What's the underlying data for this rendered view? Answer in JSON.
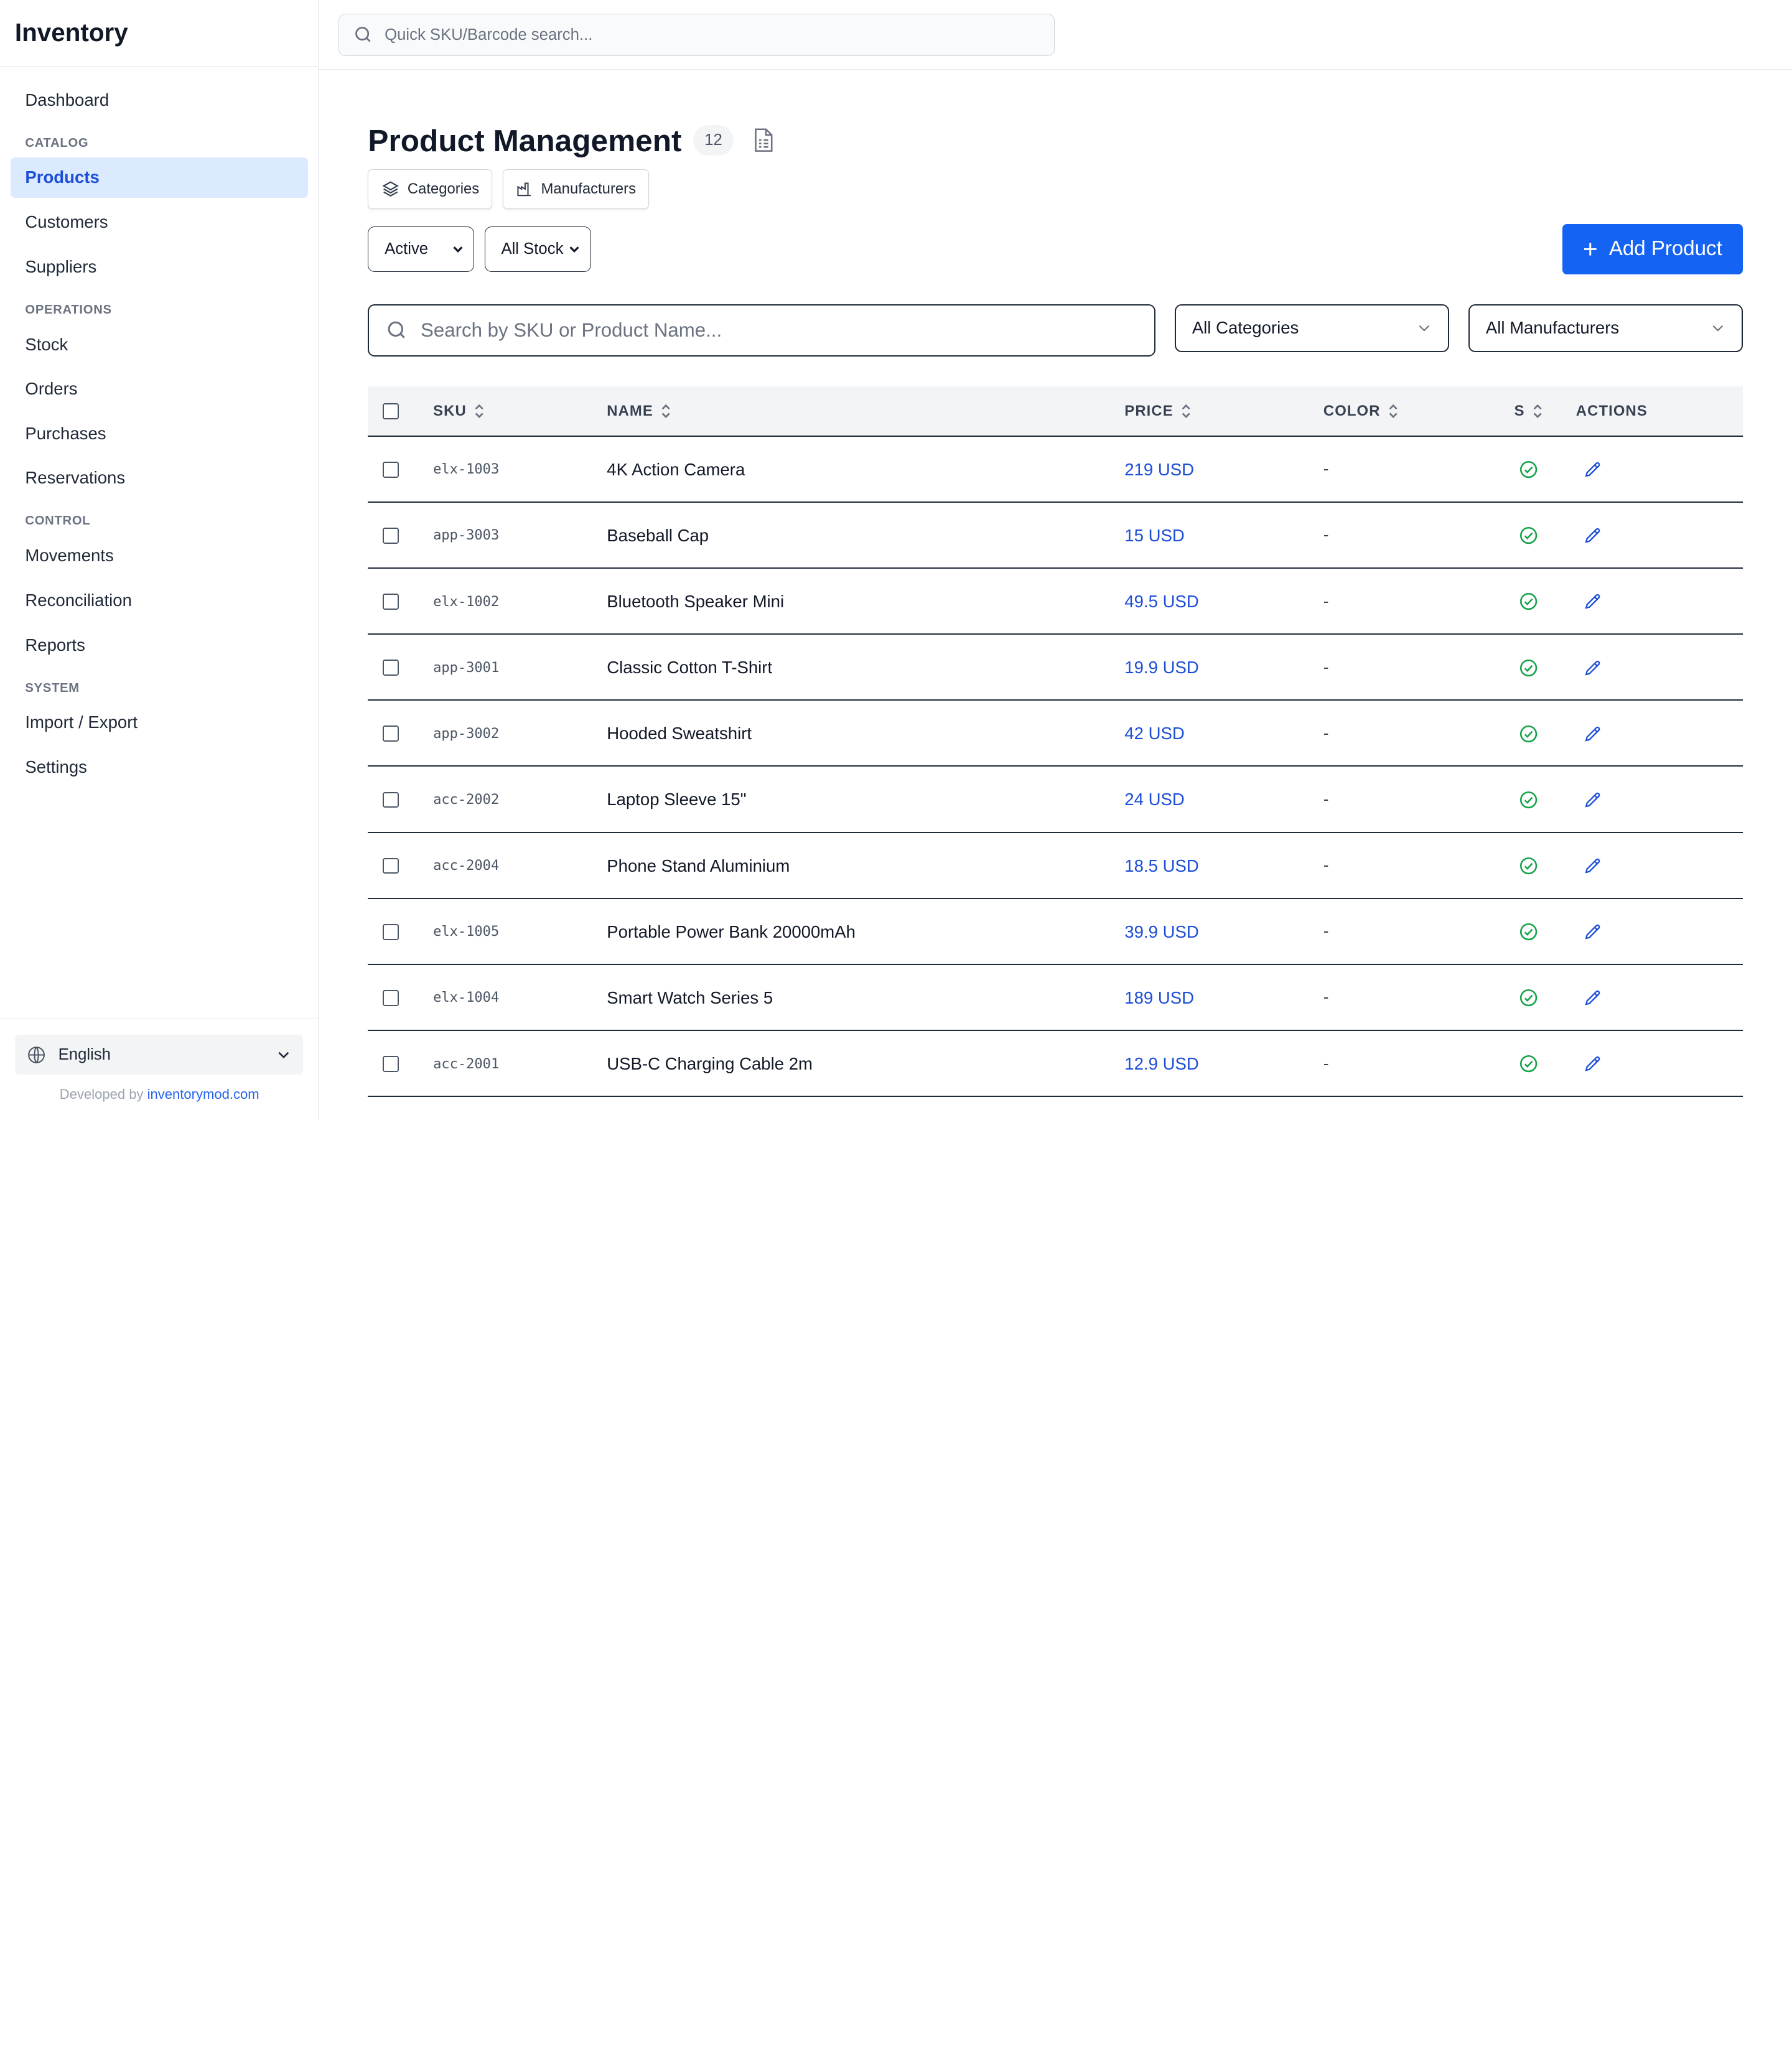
{
  "app": {
    "brand": "Inventory"
  },
  "topbar": {
    "search_placeholder": "Quick SKU/Barcode search..."
  },
  "sidebar": {
    "dashboard": "Dashboard",
    "sections": {
      "catalog": "CATALOG",
      "operations": "OPERATIONS",
      "control": "CONTROL",
      "system": "SYSTEM"
    },
    "items": {
      "products": "Products",
      "customers": "Customers",
      "suppliers": "Suppliers",
      "stock": "Stock",
      "orders": "Orders",
      "purchases": "Purchases",
      "reservations": "Reservations",
      "movements": "Movements",
      "reconciliation": "Reconciliation",
      "reports": "Reports",
      "import_export": "Import / Export",
      "settings": "Settings"
    },
    "active_item": "Products",
    "footer": {
      "language": "English",
      "developed_by": "Developed by",
      "developer_link": "inventorymod.com"
    }
  },
  "main": {
    "title": "Product Management",
    "count": "12",
    "subnav": {
      "categories": "Categories",
      "manufacturers": "Manufacturers"
    },
    "filters": {
      "status": "Active",
      "stock": "All Stock"
    },
    "add_button": "Add Product",
    "search_placeholder": "Search by SKU or Product Name...",
    "category_select": "All Categories",
    "manufacturer_select": "All Manufacturers"
  },
  "table": {
    "headers": {
      "sku": "SKU",
      "name": "NAME",
      "price": "PRICE",
      "color": "COLOR",
      "status": "S",
      "actions": "ACTIONS"
    },
    "rows": [
      {
        "sku": "elx-1003",
        "name": "4K Action Camera",
        "price": "219 USD",
        "color": "-"
      },
      {
        "sku": "app-3003",
        "name": "Baseball Cap",
        "price": "15 USD",
        "color": "-"
      },
      {
        "sku": "elx-1002",
        "name": "Bluetooth Speaker Mini",
        "price": "49.5 USD",
        "color": "-"
      },
      {
        "sku": "app-3001",
        "name": "Classic Cotton T-Shirt",
        "price": "19.9 USD",
        "color": "-"
      },
      {
        "sku": "app-3002",
        "name": "Hooded Sweatshirt",
        "price": "42 USD",
        "color": "-"
      },
      {
        "sku": "acc-2002",
        "name": "Laptop Sleeve 15\"",
        "price": "24 USD",
        "color": "-"
      },
      {
        "sku": "acc-2004",
        "name": "Phone Stand Aluminium",
        "price": "18.5 USD",
        "color": "-"
      },
      {
        "sku": "elx-1005",
        "name": "Portable Power Bank 20000mAh",
        "price": "39.9 USD",
        "color": "-"
      },
      {
        "sku": "elx-1004",
        "name": "Smart Watch Series 5",
        "price": "189 USD",
        "color": "-"
      },
      {
        "sku": "acc-2001",
        "name": "USB-C Charging Cable 2m",
        "price": "12.9 USD",
        "color": "-"
      }
    ]
  },
  "colors": {
    "accent": "#1463f3",
    "active_bg": "#dbeafe",
    "link": "#1d4ed8",
    "status_ok": "#16a34a"
  },
  "icons": {
    "status": "check-circle-icon",
    "action": "pencil-icon"
  }
}
